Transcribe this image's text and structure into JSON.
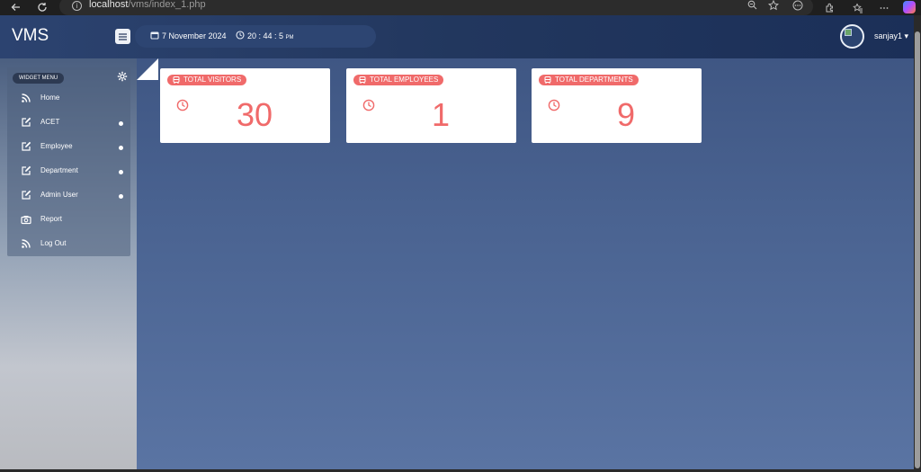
{
  "browser": {
    "url_host": "localhost",
    "url_path": "/vms/index_1.php"
  },
  "header": {
    "brand": "VMS",
    "date": "7 November 2024",
    "time": "20 : 44 : 5",
    "time_suffix": "PM",
    "user_name": "sanjay1 ▾"
  },
  "sidebar": {
    "widget_label": "WIDGET MENU",
    "items": [
      {
        "label": "Home",
        "icon": "rss-icon",
        "has_dot": false
      },
      {
        "label": "ACET",
        "icon": "edit-icon",
        "has_dot": true
      },
      {
        "label": "Employee",
        "icon": "edit-icon",
        "has_dot": true
      },
      {
        "label": "Department",
        "icon": "edit-icon",
        "has_dot": true
      },
      {
        "label": "Admin User",
        "icon": "edit-icon",
        "has_dot": true
      },
      {
        "label": "Report",
        "icon": "camera-icon",
        "has_dot": false
      },
      {
        "label": "Log Out",
        "icon": "rss-icon",
        "has_dot": false
      }
    ]
  },
  "cards": [
    {
      "title": "TOTAL VISITORS",
      "value": "30"
    },
    {
      "title": "TOTAL EMPLOYEES",
      "value": "1"
    },
    {
      "title": "TOTAL DEPARTMENTS",
      "value": "9"
    }
  ],
  "colors": {
    "accent": "#f06a6a",
    "header": "#22375e",
    "page": "#4a6391"
  }
}
